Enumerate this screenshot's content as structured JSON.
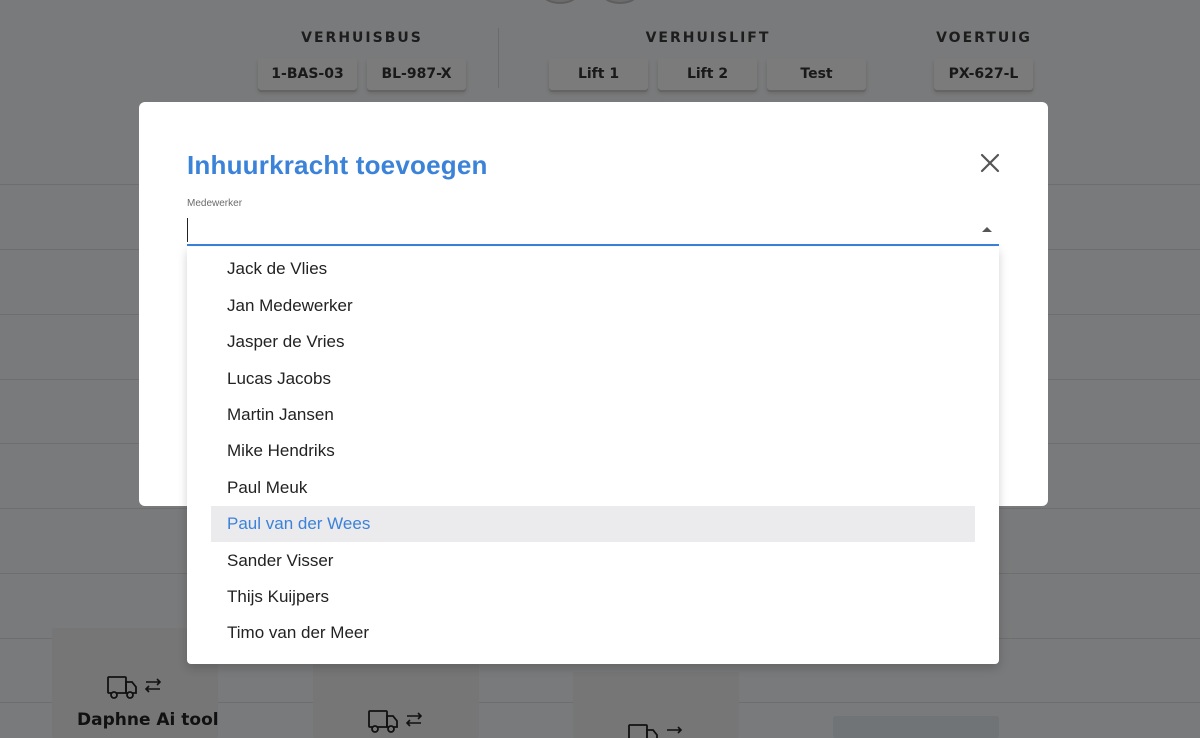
{
  "background": {
    "groups": [
      {
        "label": "VERHUISBUS",
        "chips": [
          "1-BAS-03",
          "BL-987-X"
        ]
      },
      {
        "label": "VERHUISLIFT",
        "chips": [
          "Lift 1",
          "Lift 2",
          "Test"
        ]
      },
      {
        "label": "VOERTUIG",
        "chips": [
          "PX-627-L"
        ]
      }
    ],
    "cards": [
      {
        "title": "Daphne Ai tool"
      }
    ]
  },
  "modal": {
    "title": "Inhuurkracht toevoegen",
    "field_label": "Medewerker",
    "field_value": ""
  },
  "dropdown": {
    "options": [
      "Jack de Vlies",
      "Jan Medewerker",
      "Jasper de Vries",
      "Lucas Jacobs",
      "Martin Jansen",
      "Mike Hendriks",
      "Paul Meuk",
      "Paul van der Wees",
      "Sander Visser",
      "Thijs Kuijpers",
      "Timo van der Meer"
    ],
    "highlighted": "Paul van der Wees"
  },
  "colors": {
    "accent": "#3b82d9",
    "overlay": "rgba(0,0,0,0.5)",
    "highlight_bg": "#ebebed"
  },
  "icons": {
    "close": "close-icon",
    "dropdown": "arrow-drop-up-icon",
    "card": "truck-swap-icon"
  }
}
